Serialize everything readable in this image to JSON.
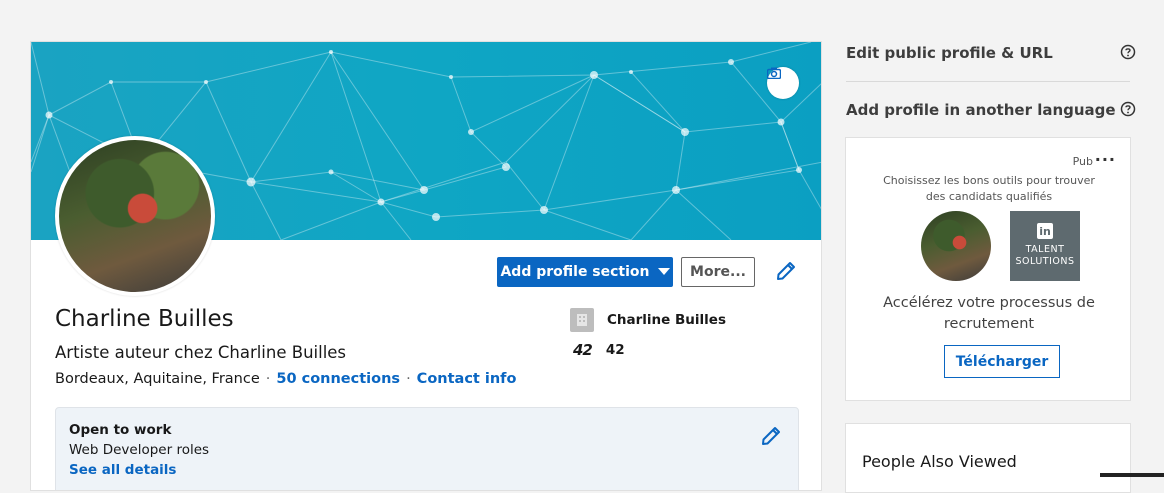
{
  "profile": {
    "name": "Charline Builles",
    "headline": "Artiste auteur chez Charline Builles",
    "location": "Bordeaux, Aquitaine, France",
    "separator": "·",
    "connections": "50 connections",
    "contact_info": "Contact info",
    "add_section_label": "Add profile section",
    "more_label": "More...",
    "company": "Charline Builles",
    "school": "42",
    "school_logo_text": "42"
  },
  "open_to_work": {
    "title": "Open to work",
    "roles": "Web Developer roles",
    "see_details": "See all details"
  },
  "sidebar": {
    "edit_public_profile": "Edit public profile & URL",
    "add_language": "Add profile in another language"
  },
  "ad": {
    "label": "Pub",
    "more": "···",
    "description": "Choisissez les bons outils pour trouver des candidats qualifiés",
    "brand_logo": "in",
    "brand_text": "TALENT\nSOLUTIONS",
    "headline": "Accélérez votre processus de recrutement",
    "cta": "Télécharger"
  },
  "people_also_viewed": {
    "title": "People Also Viewed"
  },
  "colors": {
    "accent": "#0a66c2",
    "banner": "#11a3c3",
    "background": "#f3f3f3"
  },
  "icons": [
    "camera-icon",
    "pencil-icon",
    "caret-down-icon",
    "company-icon",
    "school-logo",
    "help-icon",
    "linkedin-icon",
    "more-icon"
  ]
}
